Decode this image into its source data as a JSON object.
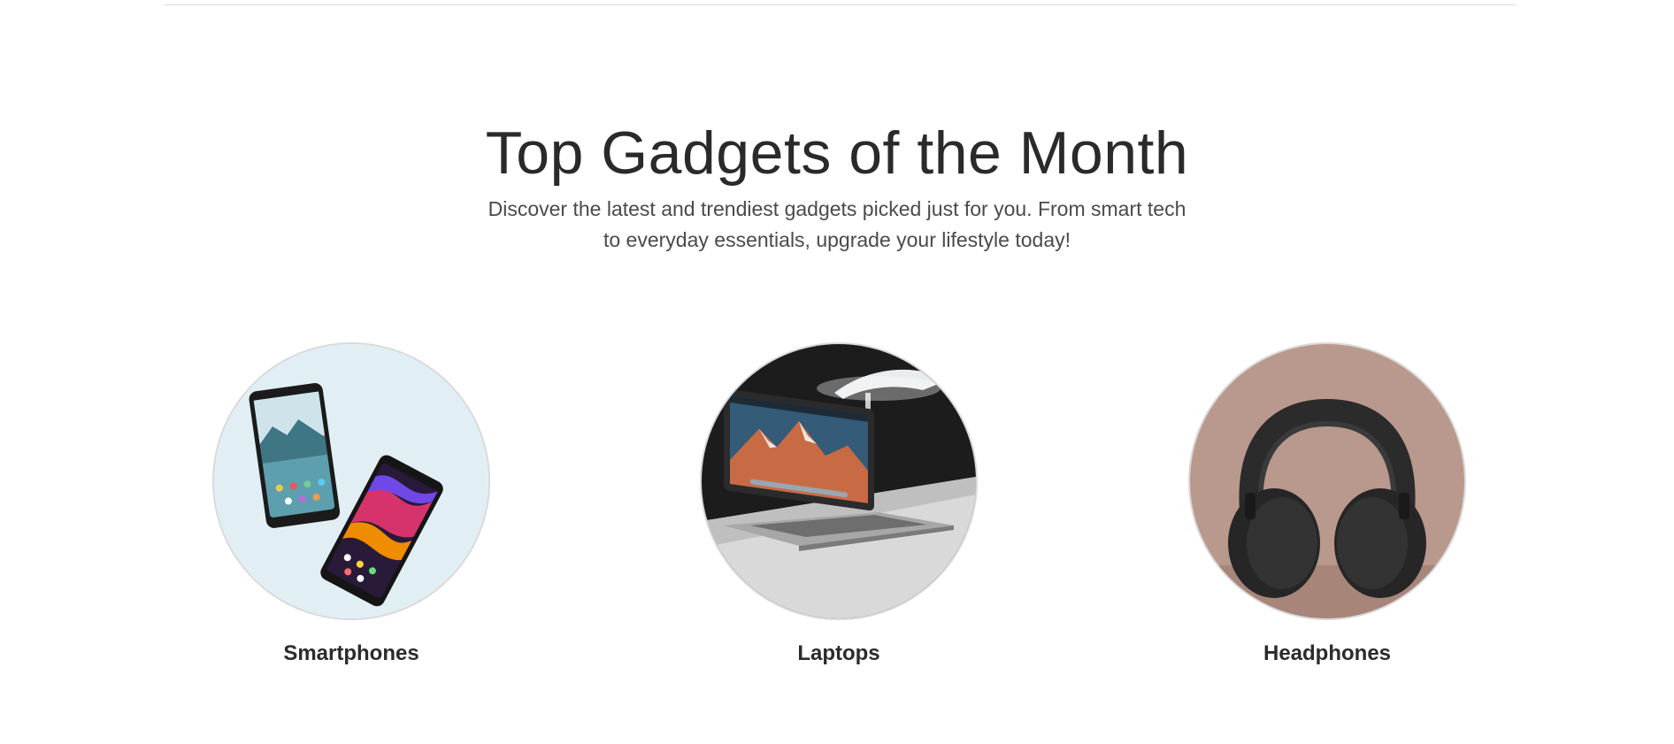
{
  "section": {
    "title": "Top Gadgets of the Month",
    "subtitle": "Discover the latest and trendiest gadgets picked just for you. From smart tech to everyday essentials, upgrade your lifestyle today!"
  },
  "categories": [
    {
      "label": "Smartphones",
      "bg": "#dfeef4"
    },
    {
      "label": "Laptops",
      "bg": "#1f1f1f"
    },
    {
      "label": "Headphones",
      "bg": "#b8968a"
    }
  ]
}
